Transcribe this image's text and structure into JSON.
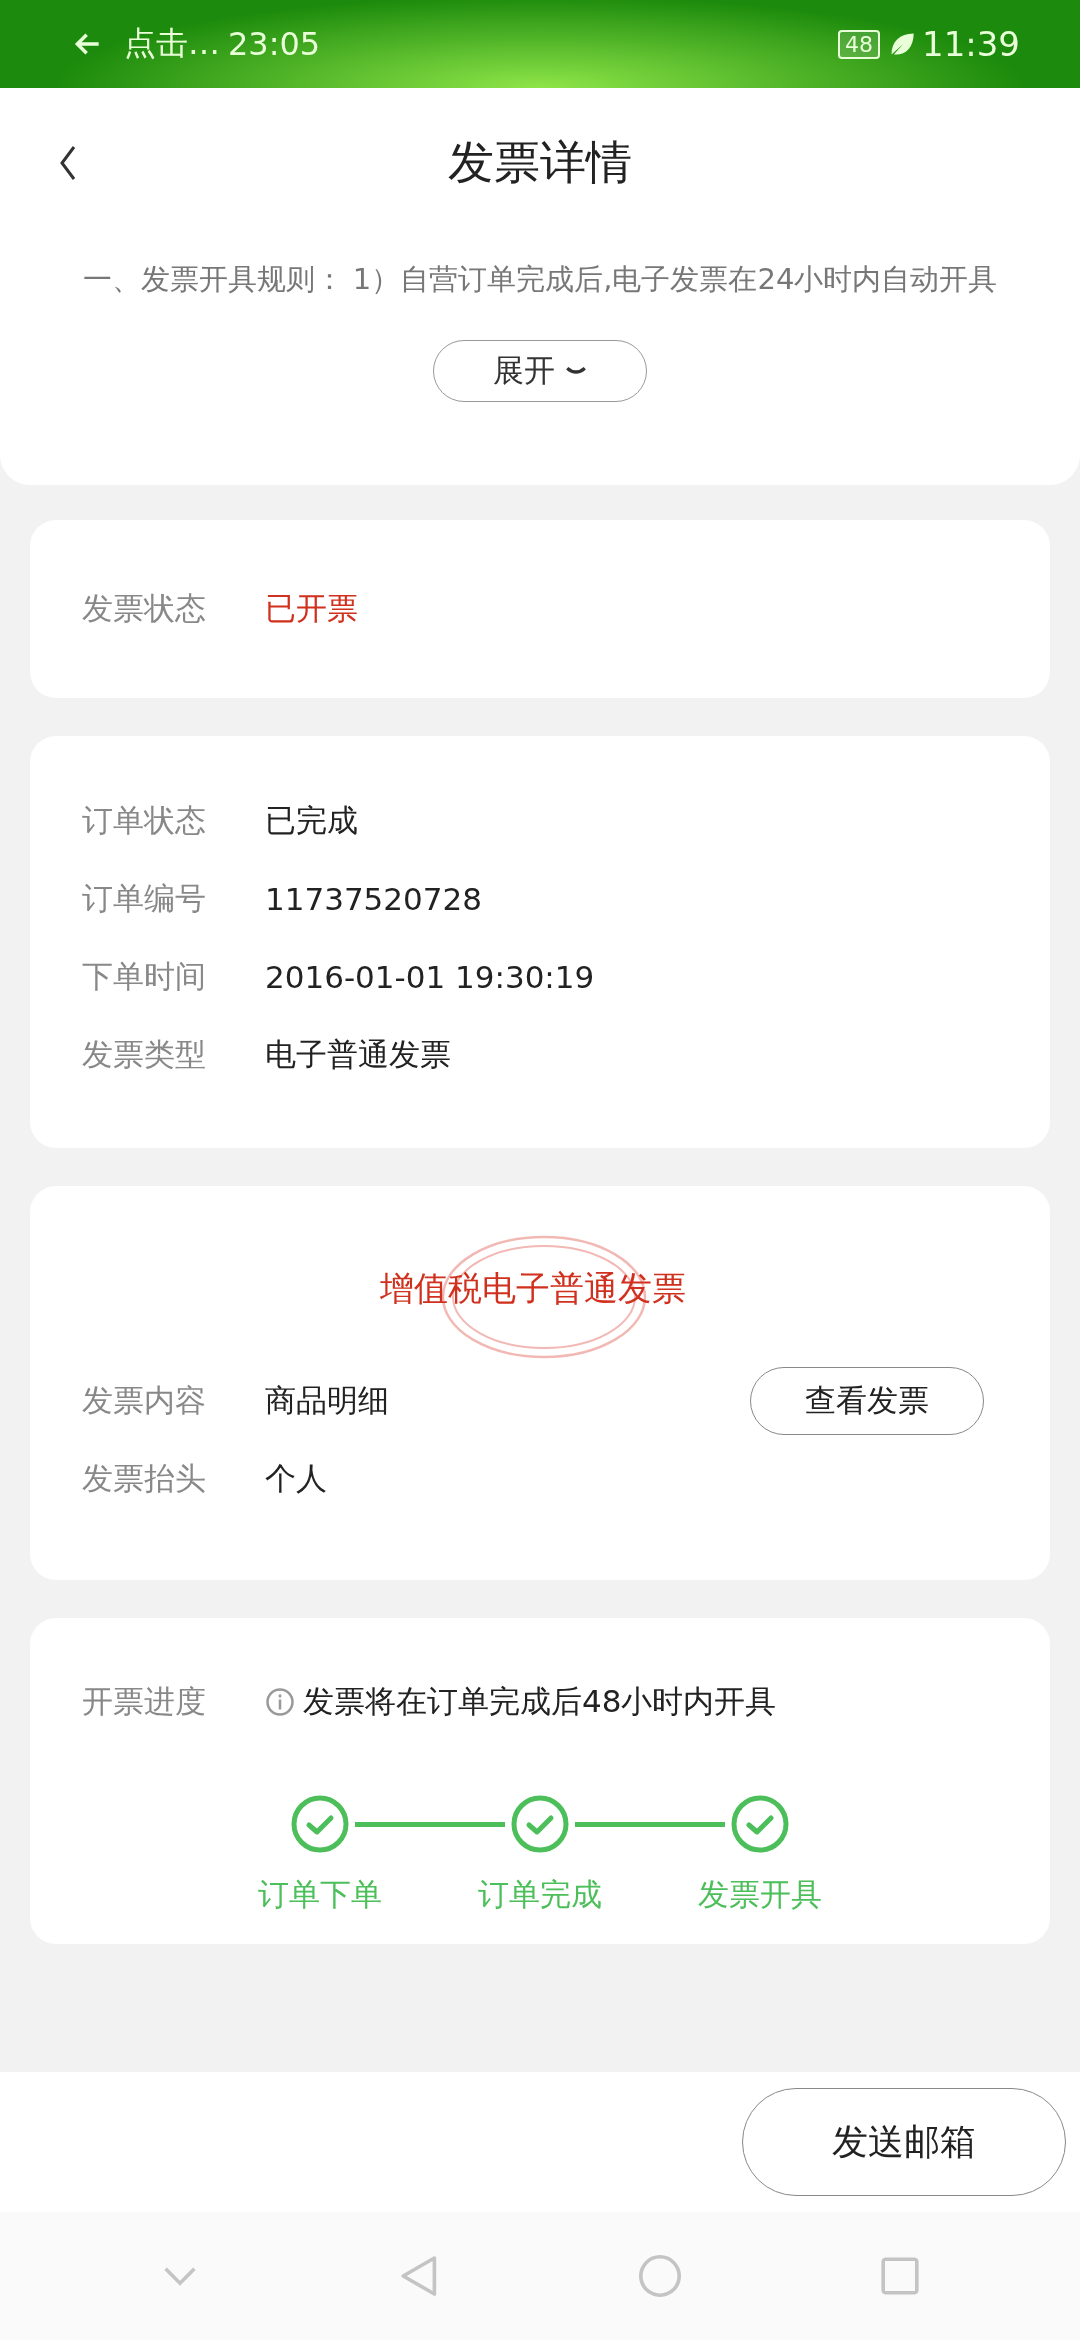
{
  "status_bar": {
    "back_text": "点击…",
    "clock_left": "23:05",
    "battery": "48",
    "time": "11:39"
  },
  "header": {
    "title": "发票详情",
    "rule_text": "一、发票开具规则： 1）自营订单完成后,电子发票在24小时内自动开具",
    "expand_label": "展开"
  },
  "invoice_status": {
    "label": "发票状态",
    "value": "已开票"
  },
  "order_info": [
    {
      "label": "订单状态",
      "value": "已完成"
    },
    {
      "label": "订单编号",
      "value": "11737520728"
    },
    {
      "label": "下单时间",
      "value": "2016-01-01 19:30:19"
    },
    {
      "label": "发票类型",
      "value": "电子普通发票"
    }
  ],
  "invoice": {
    "stamp_title": "增值税电子普通发票",
    "view_button": "查看发票",
    "rows": [
      {
        "label": "发票内容",
        "value": "商品明细"
      },
      {
        "label": "发票抬头",
        "value": "个人"
      }
    ]
  },
  "progress": {
    "label": "开票进度",
    "note": "发票将在订单完成后48小时内开具",
    "steps": [
      {
        "label": "订单下单",
        "done": true
      },
      {
        "label": "订单完成",
        "done": true
      },
      {
        "label": "发票开具",
        "done": true
      }
    ]
  },
  "footer": {
    "button": "发送邮箱"
  }
}
